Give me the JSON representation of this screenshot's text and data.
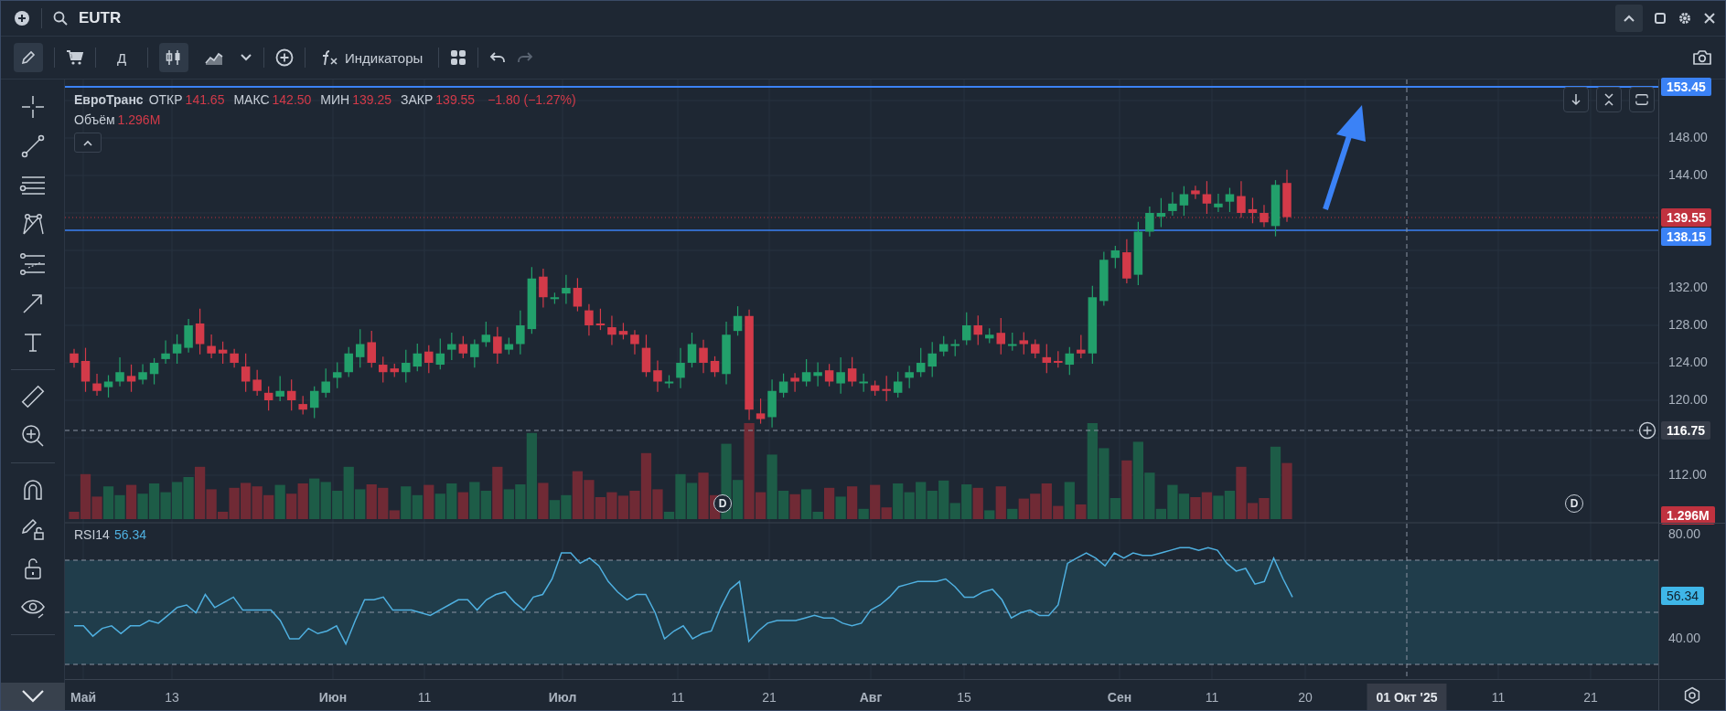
{
  "top_bar": {
    "symbol": "EUTR"
  },
  "toolbar": {
    "interval": "Д",
    "indicators_label": "Индикаторы",
    "draw_mode": {
      "selected": true
    },
    "chart_types": [
      {
        "kind": "candles",
        "selected": true
      },
      {
        "kind": "area",
        "selected": false
      }
    ],
    "redo": {
      "disabled": true
    }
  },
  "legend": {
    "name": "ЕвроТранс",
    "fields": [
      {
        "label": "ОТКР",
        "value": "141.65"
      },
      {
        "label": "МАКС",
        "value": "142.50"
      },
      {
        "label": "МИН",
        "value": "139.25"
      },
      {
        "label": "ЗАКР",
        "value": "139.55"
      }
    ],
    "change": "−1.80 (−1.27%)",
    "volume_label": "Объём",
    "volume_value": "1.296M"
  },
  "price_axis": {
    "ticks": [
      "148.00",
      "144.00",
      "132.00",
      "128.00",
      "124.00",
      "120.00",
      "112.00"
    ],
    "badges": [
      {
        "kind": "price",
        "text": "153.45",
        "color": "#3b82f6"
      },
      {
        "kind": "price",
        "text": "139.55",
        "color": "#c0323f"
      },
      {
        "kind": "price",
        "text": "138.15",
        "color": "#3b82f6"
      },
      {
        "kind": "crosshair",
        "text": "116.75",
        "color": "#363c48"
      },
      {
        "kind": "volume",
        "text": "1.296M",
        "color": "#c0323f"
      }
    ]
  },
  "event_markers": [
    {
      "text": "D"
    },
    {
      "text": "D"
    }
  ],
  "rsi": {
    "label": "RSI14",
    "value": "56.34",
    "ticks": [
      "80.00",
      "40.00"
    ],
    "badge": "56.34"
  },
  "time_axis": {
    "labels": [
      {
        "text": "Май",
        "kind": "month"
      },
      {
        "text": "13",
        "kind": "day"
      },
      {
        "text": "Июн",
        "kind": "month"
      },
      {
        "text": "11",
        "kind": "day"
      },
      {
        "text": "Июл",
        "kind": "month"
      },
      {
        "text": "11",
        "kind": "day"
      },
      {
        "text": "21",
        "kind": "day"
      },
      {
        "text": "Авг",
        "kind": "month"
      },
      {
        "text": "15",
        "kind": "day"
      },
      {
        "text": "Сен",
        "kind": "month"
      },
      {
        "text": "11",
        "kind": "day"
      },
      {
        "text": "20",
        "kind": "day"
      },
      {
        "text": "01 Окт '25",
        "kind": "cursor"
      },
      {
        "text": "11",
        "kind": "day"
      },
      {
        "text": "21",
        "kind": "day"
      }
    ]
  }
}
